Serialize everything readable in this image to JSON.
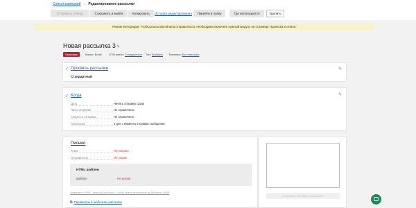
{
  "breadcrumb": {
    "link": "Список кампаний",
    "separator": "→",
    "current": "Редактирование рассылки"
  },
  "toolbar": {
    "send_now": "Отправить сейчас",
    "save_exit": "Сохранить и выйти",
    "copy": "Копировать",
    "history": "История редактирования",
    "go_to_folder": "Перейти в папку",
    "where_used": "Где используется",
    "delete": "Удалить"
  },
  "notice": "Режим интеграции. Чтобы рассылка начала отправляться, необходимо включить нужный модуль на странице Подписка и ответа.",
  "campaign": {
    "title": "Новая рассылка 3",
    "status": "Черновик",
    "channel_label": "Канал:",
    "channel_value": "Email",
    "utm_label": "UTM-метки:",
    "utm_value": "Стандартные",
    "topic_label": "Тип:",
    "topic_value": "Выбрать",
    "theme_label": "Тематика:",
    "theme_value": "Без тематики"
  },
  "profile": {
    "title": "Профиль рассылки",
    "value": "Стандартный"
  },
  "when": {
    "title": "Когда",
    "rows": [
      {
        "key": "Дата",
        "value": "Начать отправку сразу"
      },
      {
        "key": "Часы отправки",
        "value": "Не ограничены"
      },
      {
        "key": "Скорость отправки",
        "value": "Не ограничена"
      },
      {
        "key": "Актуальна",
        "value": "3 дня с момента отправки сообщения"
      }
    ]
  },
  "letter": {
    "title": "Письмо",
    "rows": [
      {
        "key": "Тема",
        "value": "Не указана"
      },
      {
        "key": "Отправитель",
        "value": "Не указан"
      }
    ],
    "template_title": "HTML шаблон",
    "template_key": "Шаблон",
    "template_value": "Не указан",
    "hint": "Загрузите HTML, вёрстку шаблона, чтобы иметь возможность добавить AMP",
    "params_link": "Параметры в шаблонах рассылки"
  },
  "preview": {
    "button": "Отправить тестовое сообщение"
  },
  "colors": {
    "accent": "#1a5fb4",
    "status_badge": "#b3262e",
    "notice_bg": "#f7f3c6",
    "error": "#c0392b",
    "fab": "#1e8a5a"
  },
  "icons": {
    "edit": "pencil-icon",
    "done": "check-icon",
    "external": "external-link-icon",
    "chat": "chat-icon"
  }
}
